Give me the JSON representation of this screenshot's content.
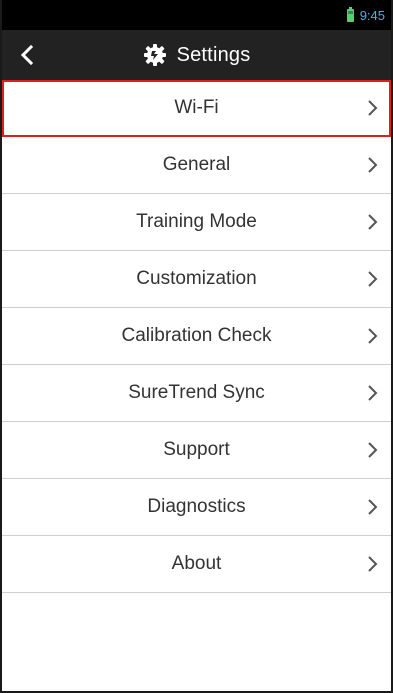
{
  "status_bar": {
    "time": "9:45",
    "battery_icon": "battery-icon"
  },
  "header": {
    "back_icon": "chevron-left-icon",
    "settings_icon": "settings-gear-icon",
    "title": "Settings"
  },
  "menu": {
    "selected_index": 0,
    "items": [
      {
        "label": "Wi-Fi"
      },
      {
        "label": "General"
      },
      {
        "label": "Training Mode"
      },
      {
        "label": "Customization"
      },
      {
        "label": "Calibration Check"
      },
      {
        "label": "SureTrend Sync"
      },
      {
        "label": "Support"
      },
      {
        "label": "Diagnostics"
      },
      {
        "label": "About"
      }
    ]
  },
  "colors": {
    "header_bg": "#222222",
    "status_bar_bg": "#000000",
    "status_text": "#4cb0e0",
    "selection_outline": "#e01e1e",
    "divider": "#cfcfcf"
  }
}
